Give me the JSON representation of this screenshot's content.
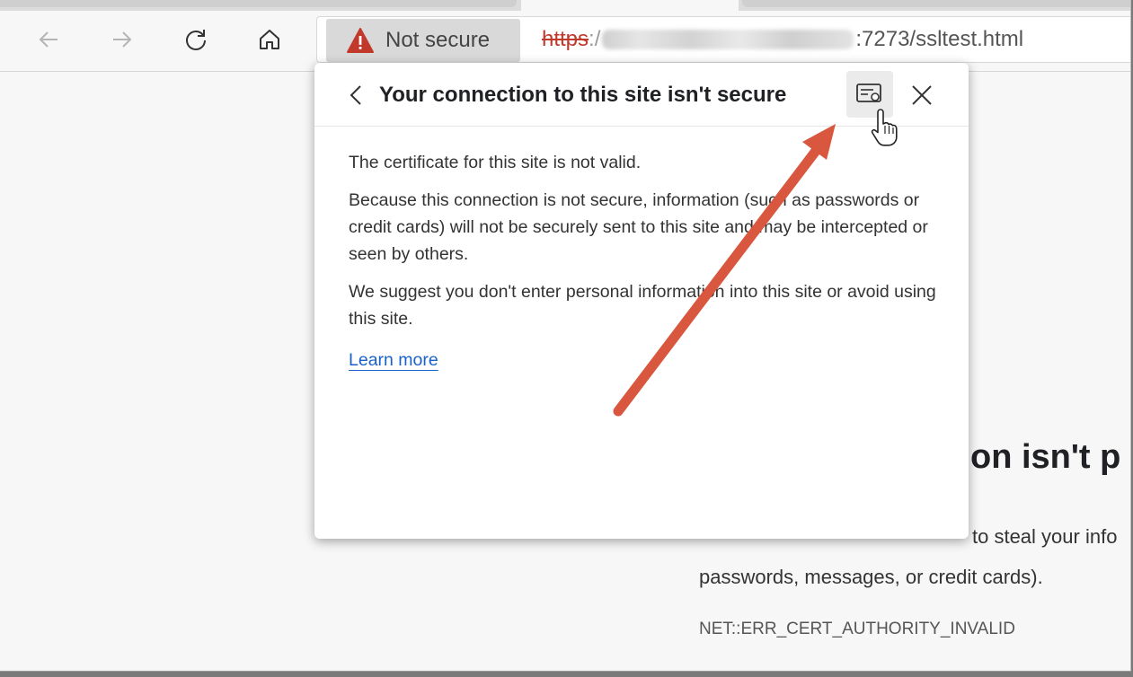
{
  "browser": {
    "nav": {
      "back_icon": "arrow-left-icon",
      "forward_icon": "arrow-right-icon",
      "refresh_icon": "refresh-icon",
      "home_icon": "home-icon"
    },
    "omnibox": {
      "security_label": "Not secure",
      "security_icon": "warning-triangle-icon",
      "warning_color": "#c0392b",
      "url_scheme": "https",
      "url_sep": ":/",
      "url_rest": ":7273/ssltest.html"
    }
  },
  "popup": {
    "title": "Your connection to this site isn't secure",
    "paragraphs": [
      "The certificate for this site is not valid.",
      "Because this connection is not secure, information (such as passwords or credit cards) will not be securely sent to this site and may be intercepted or seen by others.",
      "We suggest you don't enter personal information into this site or avoid using this site."
    ],
    "learn_more": "Learn more",
    "link_color": "#1a62c8",
    "cert_icon": "certificate-icon",
    "close_icon": "close-icon",
    "back_icon": "chevron-left-icon"
  },
  "page": {
    "heading_fragment": "on isn't p",
    "desc_line1": "to steal your info",
    "desc_line2": "passwords, messages, or credit cards).",
    "error_code": "NET::ERR_CERT_AUTHORITY_INVALID"
  },
  "annotation": {
    "arrow_color": "#d9573f"
  }
}
